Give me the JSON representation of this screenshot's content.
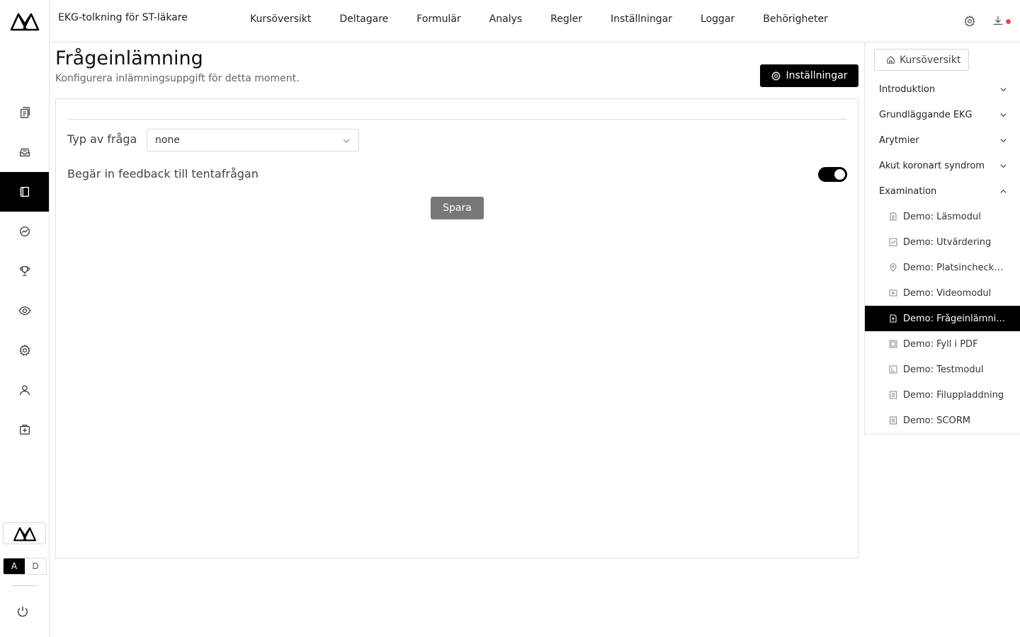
{
  "app": {
    "course_title": "EKG-tolkning för ST-läkare"
  },
  "topnav": {
    "items": [
      {
        "label": "Kursöversikt"
      },
      {
        "label": "Deltagare"
      },
      {
        "label": "Formulär"
      },
      {
        "label": "Analys"
      },
      {
        "label": "Regler"
      },
      {
        "label": "Inställningar"
      },
      {
        "label": "Loggar"
      },
      {
        "label": "Behörigheter"
      }
    ],
    "notification_color": "#e74c4c"
  },
  "rail": {
    "items": [
      {
        "icon": "documents-icon"
      },
      {
        "icon": "inbox-icon"
      },
      {
        "icon": "notebook-icon",
        "active": true
      },
      {
        "icon": "analytics-icon"
      },
      {
        "icon": "trophy-icon"
      },
      {
        "icon": "eye-icon"
      },
      {
        "icon": "gear-icon"
      },
      {
        "icon": "user-icon"
      },
      {
        "icon": "medical-kit-icon"
      }
    ],
    "theme_toggle": {
      "a": "A",
      "d": "D",
      "selected": "A"
    }
  },
  "main": {
    "title": "Frågeinlämning",
    "subtitle": "Konfigurera inlämningsuppgift för detta moment.",
    "settings_button": "Inställningar",
    "question_type_label": "Typ av fråga",
    "question_type_value": "none",
    "feedback_label": "Begär in feedback till tentafrågan",
    "feedback_enabled": true,
    "save_button": "Spara"
  },
  "sidepanel": {
    "overview_button": "Kursöversikt",
    "sections": [
      {
        "label": "Introduktion",
        "expanded": false
      },
      {
        "label": "Grundläggande EKG",
        "expanded": false
      },
      {
        "label": "Arytmier",
        "expanded": false
      },
      {
        "label": "Akut koronart syndrom",
        "expanded": false
      },
      {
        "label": "Examination",
        "expanded": true
      }
    ],
    "items": [
      {
        "label": "Demo: Läsmodul",
        "icon": "document-icon"
      },
      {
        "label": "Demo: Utvärdering",
        "icon": "chart-icon"
      },
      {
        "label": "Demo: Platsincheckning",
        "icon": "location-pin-icon"
      },
      {
        "label": "Demo: Videomodul",
        "icon": "video-icon"
      },
      {
        "label": "Demo: Frågeinlämning",
        "icon": "file-upload-icon",
        "active": true
      },
      {
        "label": "Demo: Fyll i PDF",
        "icon": "pdf-icon"
      },
      {
        "label": "Demo: Testmodul",
        "icon": "test-icon"
      },
      {
        "label": "Demo: Filuppladdning",
        "icon": "file-icon"
      },
      {
        "label": "Demo: SCORM",
        "icon": "file-icon"
      }
    ]
  }
}
